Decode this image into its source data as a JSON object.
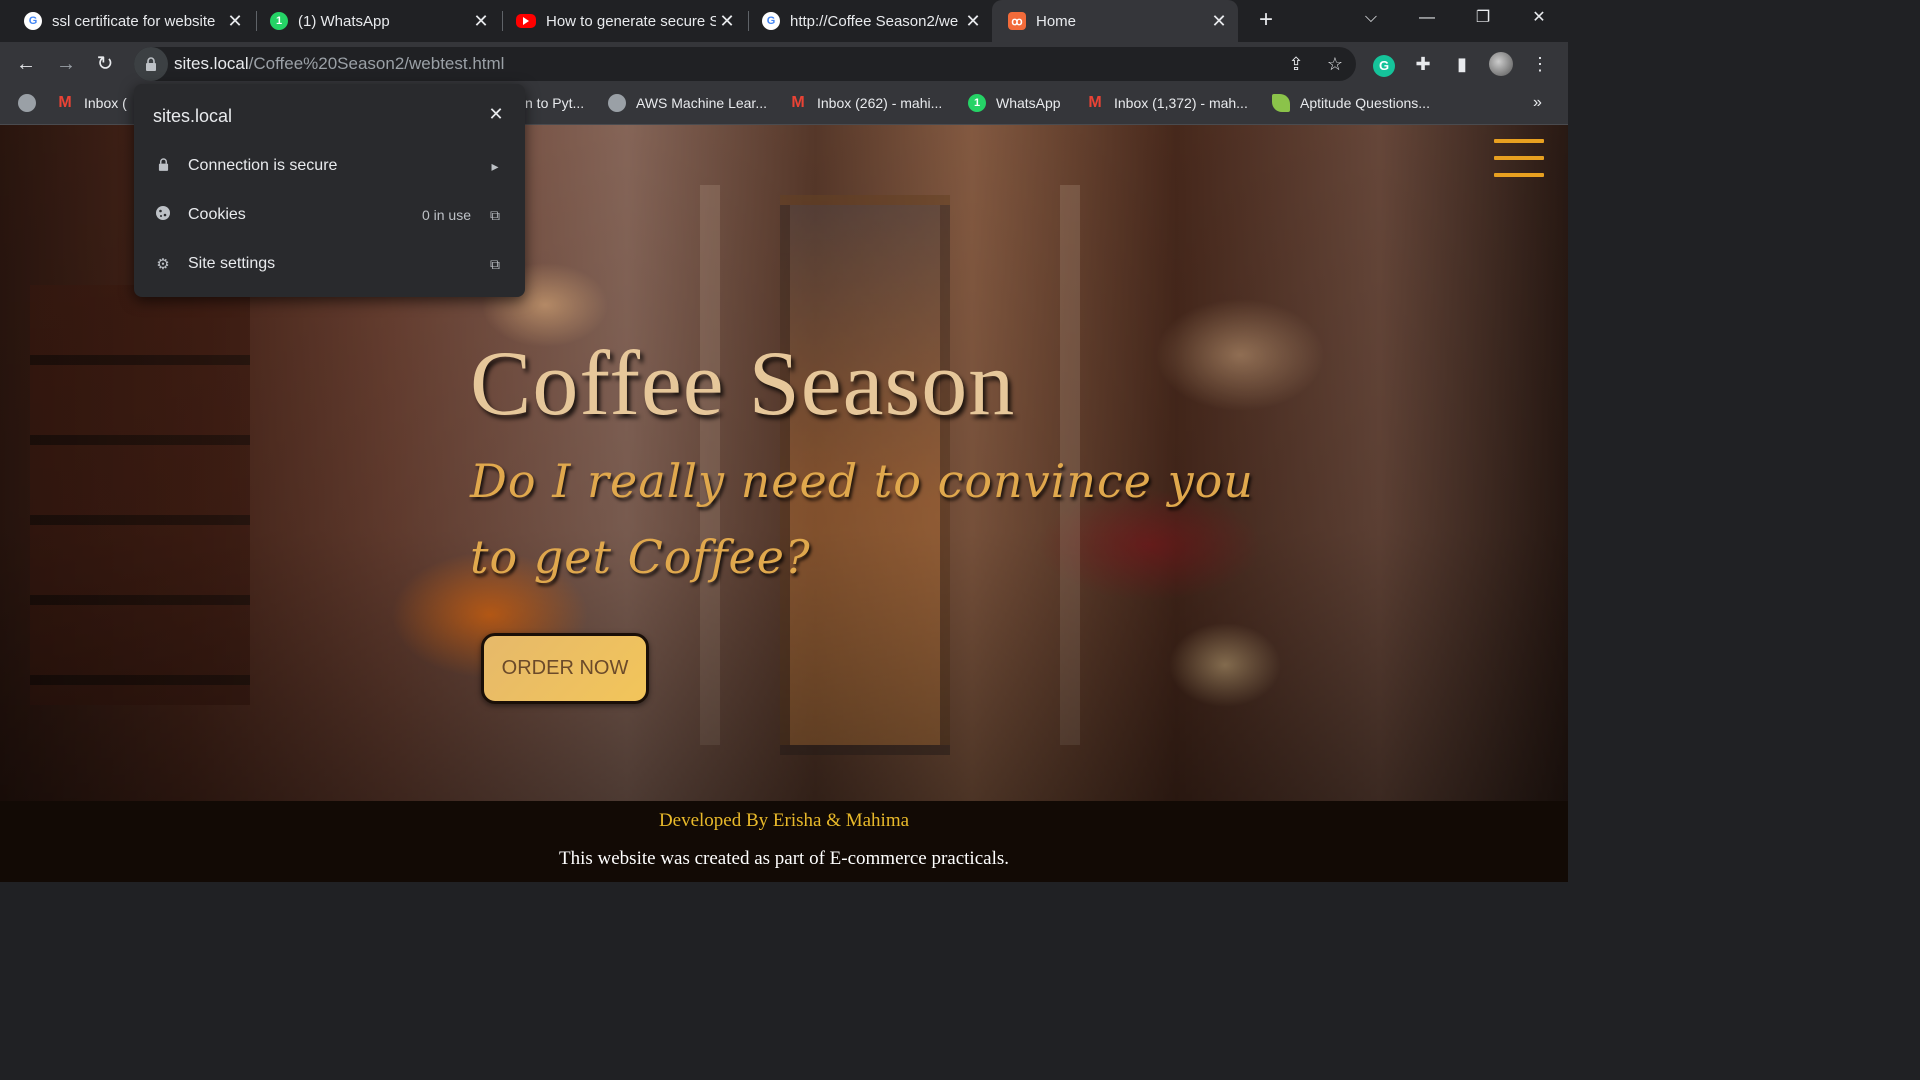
{
  "tabs": [
    {
      "title": "ssl certificate for website",
      "favicon": "google-icon"
    },
    {
      "title": "(1) WhatsApp",
      "favicon": "whatsapp-icon"
    },
    {
      "title": "How to generate secure S",
      "favicon": "youtube-icon"
    },
    {
      "title": "http://Coffee Season2/we",
      "favicon": "google-icon"
    },
    {
      "title": "Home",
      "favicon": "home-site-icon",
      "active": true
    }
  ],
  "address_bar": {
    "host": "sites.local",
    "path": "/Coffee%20Season2/webtest.html"
  },
  "bookmarks": [
    {
      "label": "Inbox (",
      "icon": "gmail-icon"
    },
    {
      "label": "n to Pyt...",
      "icon": "globe-icon"
    },
    {
      "label": "AWS Machine Lear...",
      "icon": "globe-icon"
    },
    {
      "label": "Inbox (262) - mahi...",
      "icon": "gmail-icon"
    },
    {
      "label": "WhatsApp",
      "icon": "whatsapp-icon"
    },
    {
      "label": "Inbox (1,372) - mah...",
      "icon": "gmail-icon"
    },
    {
      "label": "Aptitude Questions...",
      "icon": "leaf-icon"
    }
  ],
  "site_info_popup": {
    "host": "sites.local",
    "rows": [
      {
        "label": "Connection is secure",
        "icon": "lock-icon",
        "end_icon": "chevron-right-icon"
      },
      {
        "label": "Cookies",
        "value": "0 in use",
        "icon": "cookie-icon",
        "end_icon": "external-link-icon"
      },
      {
        "label": "Site settings",
        "icon": "gear-icon",
        "end_icon": "external-link-icon"
      }
    ]
  },
  "page": {
    "brand": "Coffee Season",
    "tagline": "Do I really need to convince you to get Coffee?",
    "order_button": "ORDER NOW",
    "footer_dev": "Developed By Erisha & Mahima",
    "footer_note": "This website was created as part of E-commerce practicals."
  },
  "colors": {
    "chrome_dark": "#202124",
    "toolbar": "#35363a",
    "brand_text": "#e6c79a",
    "tagline_text": "#e0a84d",
    "accent_orange": "#e8a020",
    "footer_bg": "#120a05",
    "footer_dev_text": "#e8b92a"
  }
}
